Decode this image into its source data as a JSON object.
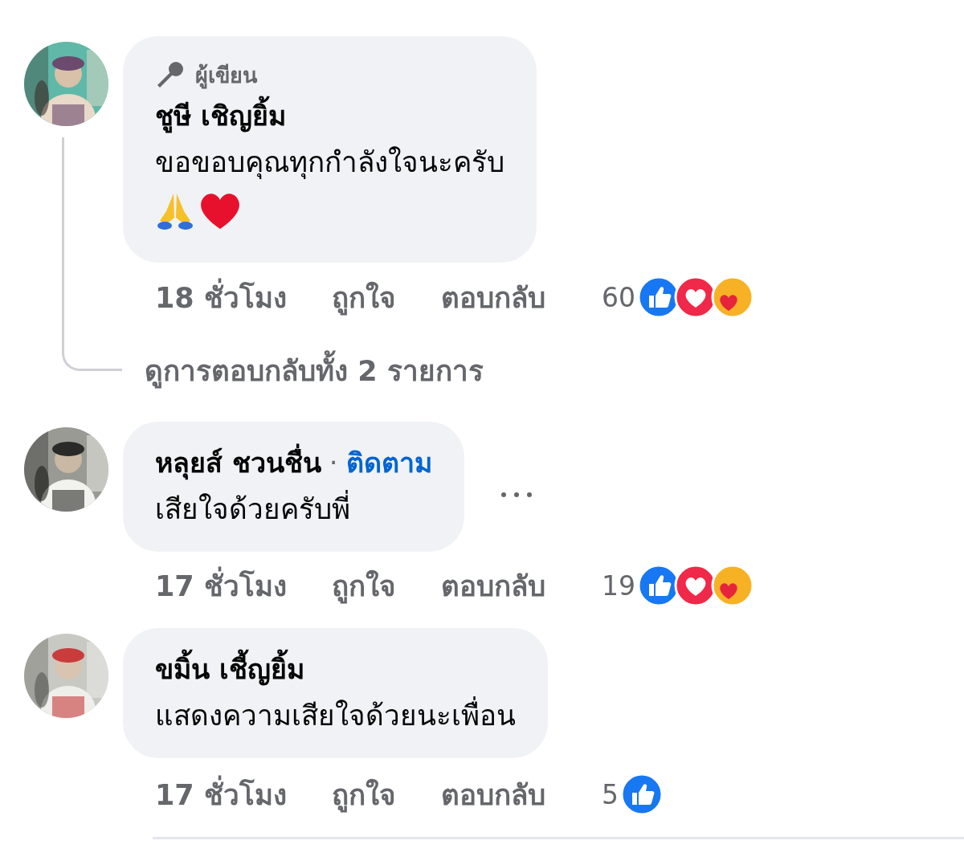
{
  "comments": [
    {
      "avatar": {
        "kind": "picture"
      },
      "author_badge": "ผู้เขียน",
      "author": "ชูษี เชิญยิ้ม",
      "text": "ขอขอบคุณทุกกำลังใจนะครับ",
      "emojis": [
        {
          "kind": "pray"
        },
        {
          "kind": "heart"
        }
      ],
      "time": "18 ชั่วโมง",
      "like_action": "ถูกใจ",
      "reply_action": "ตอบกลับ",
      "reaction_count": "60",
      "reactions": [
        {
          "kind": "like"
        },
        {
          "kind": "love"
        },
        {
          "kind": "care"
        }
      ],
      "view_replies": "ดูการตอบกลับทั้ง 2 รายการ"
    },
    {
      "avatar": {
        "kind": "picture"
      },
      "author": "หลุยส์ ชวนชื่น",
      "separator": "·",
      "follow": "ติดตาม",
      "text": "เสียใจด้วยครับพี่",
      "more_menu": true,
      "time": "17 ชั่วโมง",
      "like_action": "ถูกใจ",
      "reply_action": "ตอบกลับ",
      "reaction_count": "19",
      "reactions": [
        {
          "kind": "like"
        },
        {
          "kind": "love"
        },
        {
          "kind": "care"
        }
      ]
    },
    {
      "avatar": {
        "kind": "picture"
      },
      "author": "ขมิ้น เชี้ญยิ้ม",
      "text": "แสดงความเสียใจด้วยนะเพื่อน",
      "time": "17 ชั่วโมง",
      "like_action": "ถูกใจ",
      "reply_action": "ตอบกลับ",
      "reaction_count": "5",
      "reactions": [
        {
          "kind": "like"
        }
      ]
    }
  ]
}
